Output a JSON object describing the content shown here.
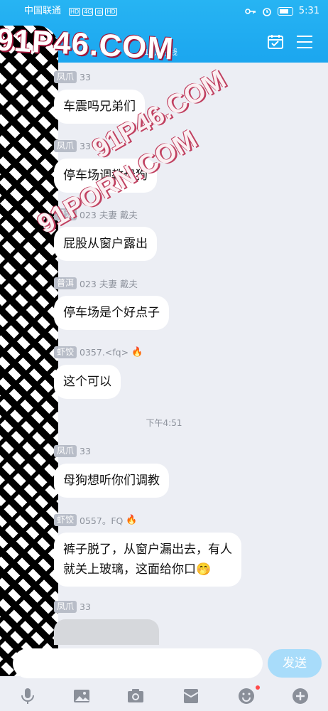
{
  "status_bar": {
    "carrier": "中国联通",
    "net_badges": [
      "HD",
      "4G",
      "◎",
      "HD"
    ],
    "time": "5:31"
  },
  "header": {
    "member_count": "115人在线",
    "watermark": "91P46.COM",
    "watermark_diag_1": "91P46.COM",
    "watermark_diag_2": "91PORN.COM"
  },
  "messages": [
    {
      "badge": "凤爪",
      "meta": "33",
      "text": "车震吗兄弟们"
    },
    {
      "badge": "凤爪",
      "meta": "33",
      "text": "停车场调教母狗"
    },
    {
      "badge": "普洱",
      "meta": "023 夫妻 戴夫",
      "text": "屁股从窗户露出"
    },
    {
      "badge": "普洱",
      "meta": "023 夫妻 戴夫",
      "text": "停车场是个好点子"
    },
    {
      "badge": "虾饺",
      "meta": "0357.<fq>",
      "text": "这个可以",
      "fire": "🔥"
    },
    {
      "badge": "凤爪",
      "meta": "33",
      "text": "母狗想听你们调教"
    },
    {
      "badge": "虾饺",
      "meta": "0557。FQ",
      "text_line1": "裤子脱了，从窗户漏出去，有人",
      "text_line2": "就关上玻璃，这面给你口🤭",
      "fire": "🔥"
    },
    {
      "badge": "凤爪",
      "meta": "33"
    }
  ],
  "time_divider": "下午4:51",
  "input": {
    "send_label": "发送"
  },
  "colors": {
    "header_blue": "#1ba6ef",
    "send_button": "#a8dcfa",
    "badge_gray": "#b8bdc8"
  },
  "toolbar_icons": [
    "microphone-icon",
    "image-icon",
    "camera-icon",
    "red-packet-icon",
    "emoji-icon",
    "plus-icon"
  ]
}
